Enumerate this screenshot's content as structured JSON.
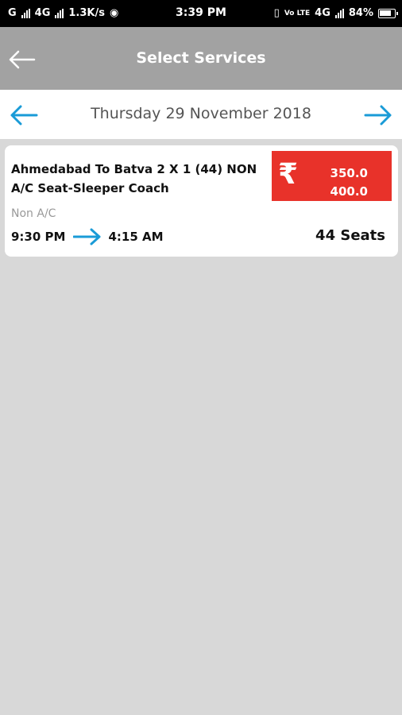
{
  "status_bar": {
    "left_text": "G",
    "network": "4G",
    "speed": "1.3K/s",
    "time": "3:39 PM",
    "right_network": "4G",
    "battery": "84%"
  },
  "app_bar": {
    "title": "Select Services",
    "back_icon": "arrow-left-icon"
  },
  "date_bar": {
    "date": "Thursday 29 November 2018",
    "prev_icon": "arrow-left-icon",
    "next_icon": "arrow-right-icon",
    "accent_color": "#1a9bd7"
  },
  "services": [
    {
      "name": "Ahmedabad To Batva 2 X 1 (44) NON A/C Seat-Sleeper Coach",
      "currency_symbol": "₹",
      "fares": [
        "350.0",
        "400.0"
      ],
      "bus_type": "Non A/C",
      "departure": "9:30 PM",
      "arrival": "4:15 AM",
      "seats": "44 Seats",
      "fare_color": "#e8322a"
    }
  ]
}
